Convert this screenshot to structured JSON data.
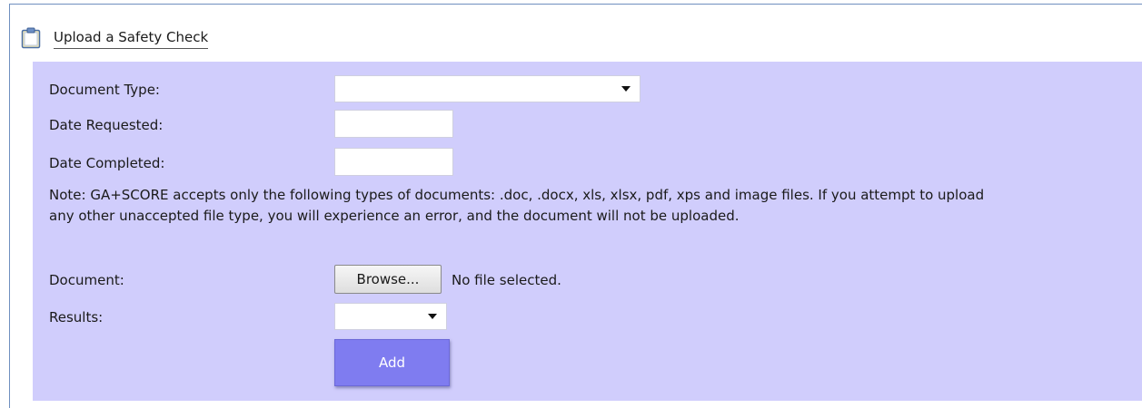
{
  "header": {
    "title": "Upload a Safety Check",
    "icon": "clipboard-icon"
  },
  "form": {
    "document_type_label": "Document Type:",
    "document_type_value": "",
    "date_requested_label": "Date Requested:",
    "date_requested_value": "",
    "date_completed_label": "Date Completed:",
    "date_completed_value": "",
    "note": "Note: GA+SCORE accepts only the following types of documents: .doc, .docx, xls, xlsx, pdf, xps and image files. If you attempt to upload any other unaccepted file type, you will experience an error, and the document will not be uploaded.",
    "document_label": "Document:",
    "browse_label": "Browse...",
    "file_status": "No file selected.",
    "results_label": "Results:",
    "results_value": "",
    "add_label": "Add"
  },
  "colors": {
    "panel_background": "#d0cdfc",
    "add_button": "#7f7cf0",
    "frame_border": "#6f8fbf"
  }
}
